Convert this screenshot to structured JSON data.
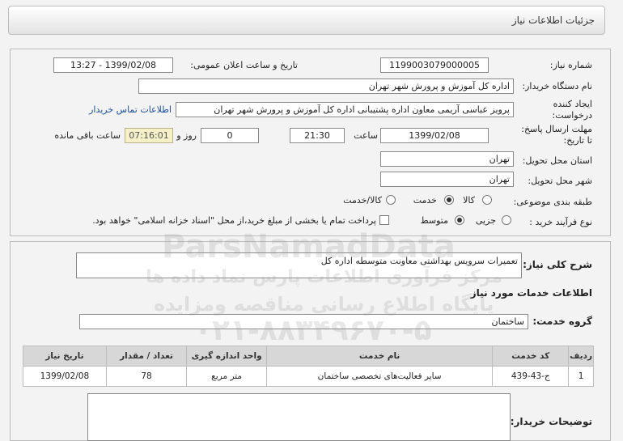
{
  "header": {
    "title": "جزئیات اطلاعات نیاز"
  },
  "need_number": {
    "label": "شماره نیاز:",
    "value": "1199003079000005"
  },
  "announce": {
    "label": "تاریخ و ساعت اعلان عمومی:",
    "value": "1399/02/08 - 13:27"
  },
  "buyer": {
    "label": "نام دستگاه خریدار:",
    "value": "اداره کل آموزش و پرورش شهر تهران"
  },
  "creator": {
    "label_line1": "ایجاد کننده",
    "label_line2": "درخواست:",
    "value": "پرویز عباسی آریمی  معاون اداره پشتیبانی  اداره کل آموزش و پرورش شهر تهران",
    "contact_link": "اطلاعات تماس خریدار"
  },
  "deadline": {
    "label_line1": "مهلت ارسال پاسخ:",
    "label_line2": "تا تاریخ:",
    "date": "1399/02/08",
    "time_label": "ساعت",
    "time": "21:30",
    "days": "0",
    "days_label": "روز و",
    "remaining": "07:16:01",
    "remaining_label": "ساعت باقی مانده"
  },
  "province": {
    "label": "استان محل تحویل:",
    "value": "تهران"
  },
  "city": {
    "label": "شهر محل تحویل:",
    "value": "تهران"
  },
  "category": {
    "label": "طبقه بندی موضوعی:",
    "options": [
      "کالا",
      "خدمت",
      "کالا/خدمت"
    ],
    "selected": "خدمت"
  },
  "purchase_type": {
    "label": "نوع فرآیند خرید :",
    "options": [
      "جزیی",
      "متوسط"
    ],
    "selected": "متوسط",
    "payment_note": "پرداخت تمام یا بخشی از مبلغ خرید،از محل \"اسناد خزانه اسلامی\" خواهد بود."
  },
  "description": {
    "label": "شرح کلی نیاز:",
    "value": "تعمیرات سرویس بهداشتی معاونت متوسطه اداره کل"
  },
  "services_title": "اطلاعات خدمات مورد نیاز",
  "service_group": {
    "label": "گروه خدمت:",
    "value": "ساختمان"
  },
  "table": {
    "headers": [
      "ردیف",
      "کد خدمت",
      "نام خدمت",
      "واحد اندازه گیری",
      "تعداد / مقدار",
      "تاریخ نیاز"
    ],
    "rows": [
      [
        "1",
        "ج-43-439",
        "سایر فعالیت‌های تخصصی ساختمان",
        "متر مربع",
        "78",
        "1399/02/08"
      ]
    ]
  },
  "buyer_notes": {
    "label": "توضیحات خریدار:",
    "value": ""
  },
  "watermark": {
    "line1": "ParsNamadData",
    "line2": "مرکز فرآوری اطلاعات پارس نماد داده ها",
    "line3": "پایگاه اطلاع رسانی مناقصه ومزایده",
    "line4": "۰۲۱-۸۸۳۴۹۶۷۰-۵"
  }
}
